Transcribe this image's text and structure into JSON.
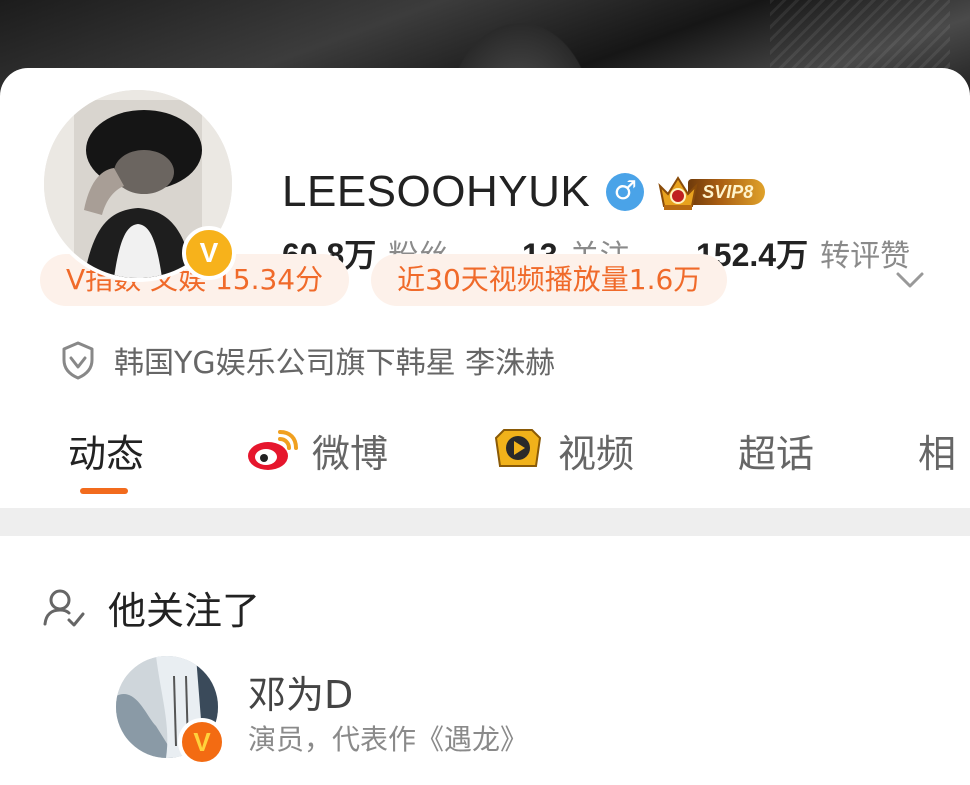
{
  "profile": {
    "name": "LEESOOHYUK",
    "gender_symbol": "♂",
    "vip_label": "SVIP8",
    "verified_badge": "V",
    "stats": [
      {
        "value": "60.8万",
        "label": "粉丝"
      },
      {
        "value": "13",
        "label": "关注"
      },
      {
        "value": "152.4万",
        "label": "转评赞"
      }
    ],
    "pills": [
      "V指数 文娱 15.34分",
      "近30天视频播放量1.6万"
    ],
    "verification": "韩国YG娱乐公司旗下韩星 李洙赫"
  },
  "tabs": [
    {
      "label": "动态",
      "icon": ""
    },
    {
      "label": "微博",
      "icon": "weibo-icon"
    },
    {
      "label": "视频",
      "icon": "video-play-icon"
    },
    {
      "label": "超话",
      "icon": ""
    },
    {
      "label": "相",
      "icon": ""
    }
  ],
  "following": {
    "heading": "他关注了",
    "user": {
      "name": "邓为D",
      "description": "演员，代表作《遇龙》",
      "badge": "V"
    }
  },
  "colors": {
    "accent": "#f26b1d",
    "pill_bg": "#fdf1ea",
    "pill_text": "#f06a2a",
    "gender_blue": "#4aa3e8",
    "badge_gold": "#f7b21b"
  }
}
